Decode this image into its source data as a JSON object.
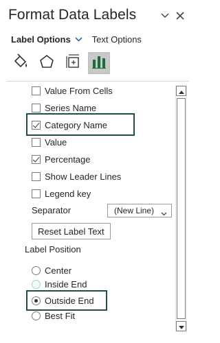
{
  "header": {
    "title": "Format Data Labels",
    "dropdown_icon": "chevron-down-icon",
    "close_icon": "close-icon"
  },
  "tabs": {
    "active": "Label Options",
    "other": "Text Options"
  },
  "icons": [
    "fill-line-icon",
    "effects-pentagon-icon",
    "size-properties-icon",
    "bar-chart-icon"
  ],
  "options": {
    "value_from_cells": {
      "label": "Value From Cells",
      "accel": "F",
      "checked": false
    },
    "series_name": {
      "label": "Series Name",
      "accel": "S",
      "checked": false
    },
    "category_name": {
      "label": "Category Name",
      "accel": "G",
      "checked": true
    },
    "value": {
      "label": "Value",
      "accel": "V",
      "checked": false
    },
    "percentage": {
      "label": "Percentage",
      "accel": "P",
      "checked": true
    },
    "show_leader_lines": {
      "label": "Show Leader Lines",
      "accel": "H",
      "checked": false
    },
    "legend_key": {
      "label": "Legend key",
      "accel": "L",
      "checked": false
    }
  },
  "separator": {
    "label": "Separator",
    "value": "(New Line)"
  },
  "reset_button": "Reset Label Text",
  "label_position": {
    "title": "Label Position",
    "options": [
      {
        "label": "Center",
        "selected": false
      },
      {
        "label": "Inside End",
        "selected": false
      },
      {
        "label": "Outside End",
        "selected": true
      },
      {
        "label": "Best Fit",
        "selected": false
      }
    ]
  },
  "colors": {
    "highlight_border": "#1f4e4e",
    "accent_chevron": "#2b6cb0"
  }
}
